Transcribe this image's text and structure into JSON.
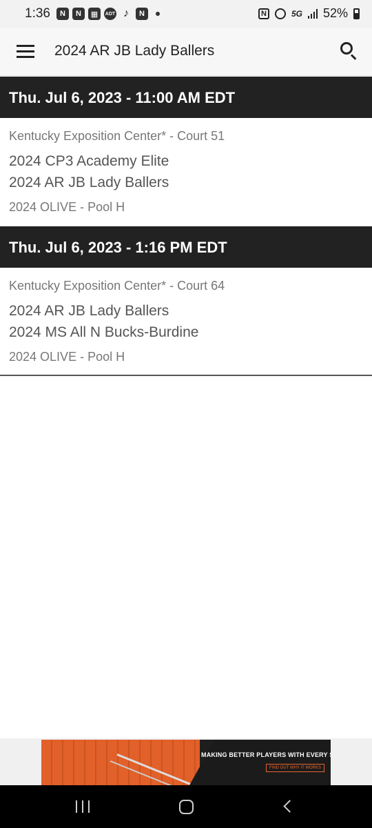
{
  "status_bar": {
    "time": "1:36",
    "network": "5G",
    "battery": "52%",
    "notification_icons": [
      "n-icon",
      "n-icon",
      "calendar-icon",
      "adt-icon",
      "tiktok-icon",
      "n-icon"
    ]
  },
  "app_bar": {
    "title": "2024 AR JB Lady Ballers"
  },
  "games": [
    {
      "date": "Thu. Jul 6, 2023 - 11:00 AM EDT",
      "venue": "Kentucky Exposition Center* - Court 51",
      "team1": "2024 CP3 Academy Elite",
      "team2": "2024 AR JB Lady Ballers",
      "pool": "2024 OLIVE - Pool H"
    },
    {
      "date": "Thu. Jul 6, 2023 - 1:16 PM EDT",
      "venue": "Kentucky Exposition Center* - Court 64",
      "team1": "2024 AR JB Lady Ballers",
      "team2": "2024 MS All N Bucks-Burdine",
      "pool": "2024 OLIVE - Pool H"
    }
  ],
  "ad": {
    "headline": "MAKING BETTER PLAYERS WITH EVERY SHOT",
    "cta": "FIND OUT WHY IT WORKS",
    "accent_color": "#e8652d"
  },
  "colors": {
    "header_bg": "#222222",
    "text_secondary": "#777777"
  }
}
